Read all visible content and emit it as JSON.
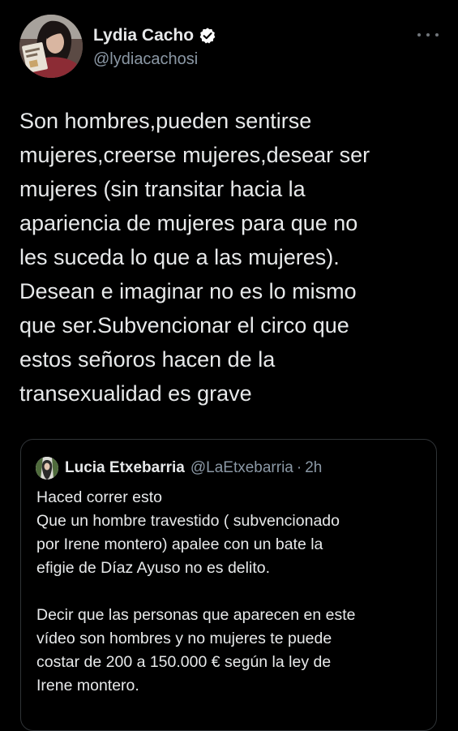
{
  "tweet": {
    "author": {
      "name": "Lydia Cacho",
      "handle": "@lydiacachosi",
      "verified": true,
      "avatar_icon": "profile-photo"
    },
    "more_icon": "more-horizontal-icon",
    "text": "Son hombres,pueden sentirse\nmujeres,creerse mujeres,desear ser\nmujeres (sin transitar hacia la\napariencia de mujeres para que no\nles suceda lo que a las mujeres).\nDesean e imaginar no es lo mismo\nque ser.Subvencionar el circo que\nestos señoros hacen de la\ntransexualidad es grave"
  },
  "quoted_tweet": {
    "author": {
      "name": "Lucia Etxebarria",
      "handle": "@LaEtxebarria",
      "separator": "·",
      "time": "2h",
      "avatar_icon": "profile-photo"
    },
    "text": "Haced correr esto\nQue un hombre travestido ( subvencionado\npor Irene montero) apalee con un bate la\nefigie de Díaz Ayuso no es delito.\n\nDecir que las personas que aparecen en este\nvídeo son hombres y no mujeres te puede\ncostar de 200 a 150.000 € según la ley de\nIrene montero."
  },
  "colors": {
    "background": "#000000",
    "text_primary": "#e7e9ea",
    "text_secondary": "#8b98a5",
    "border": "#2f3336",
    "verified": "#ffffff"
  }
}
